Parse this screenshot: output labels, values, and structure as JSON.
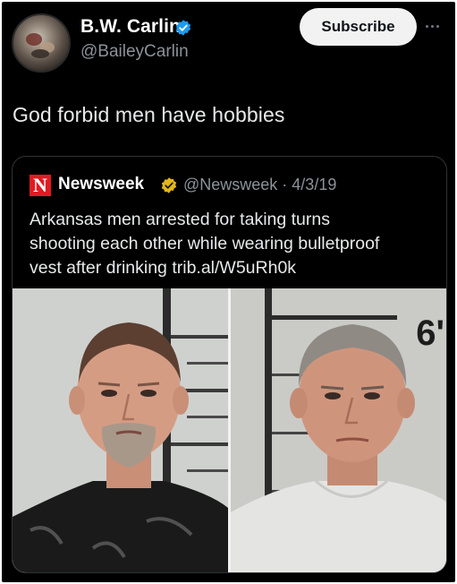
{
  "author": {
    "display_name": "B.W. Carlin",
    "handle": "@BaileyCarlin",
    "verified_icon": "verified-badge-icon"
  },
  "actions": {
    "subscribe_label": "Subscribe",
    "more_icon": "more-options-icon"
  },
  "tweet": {
    "text": "God forbid men have hobbies"
  },
  "quoted": {
    "logo_letter": "N",
    "source_name": "Newsweek",
    "source_badge_icon": "gold-verified-badge-icon",
    "handle_date": "@Newsweek · 4/3/19",
    "text_lines": [
      "Arkansas men arrested for taking turns",
      "shooting each other while wearing bulletproof",
      "vest after drinking trib.al/W5uRh0k"
    ],
    "image": {
      "height_mark": "6'"
    }
  },
  "colors": {
    "background": "#000000",
    "verified_blue": "#1d9bf0",
    "newsweek_red": "#e11b22",
    "gold_badge": "#e2b719"
  }
}
